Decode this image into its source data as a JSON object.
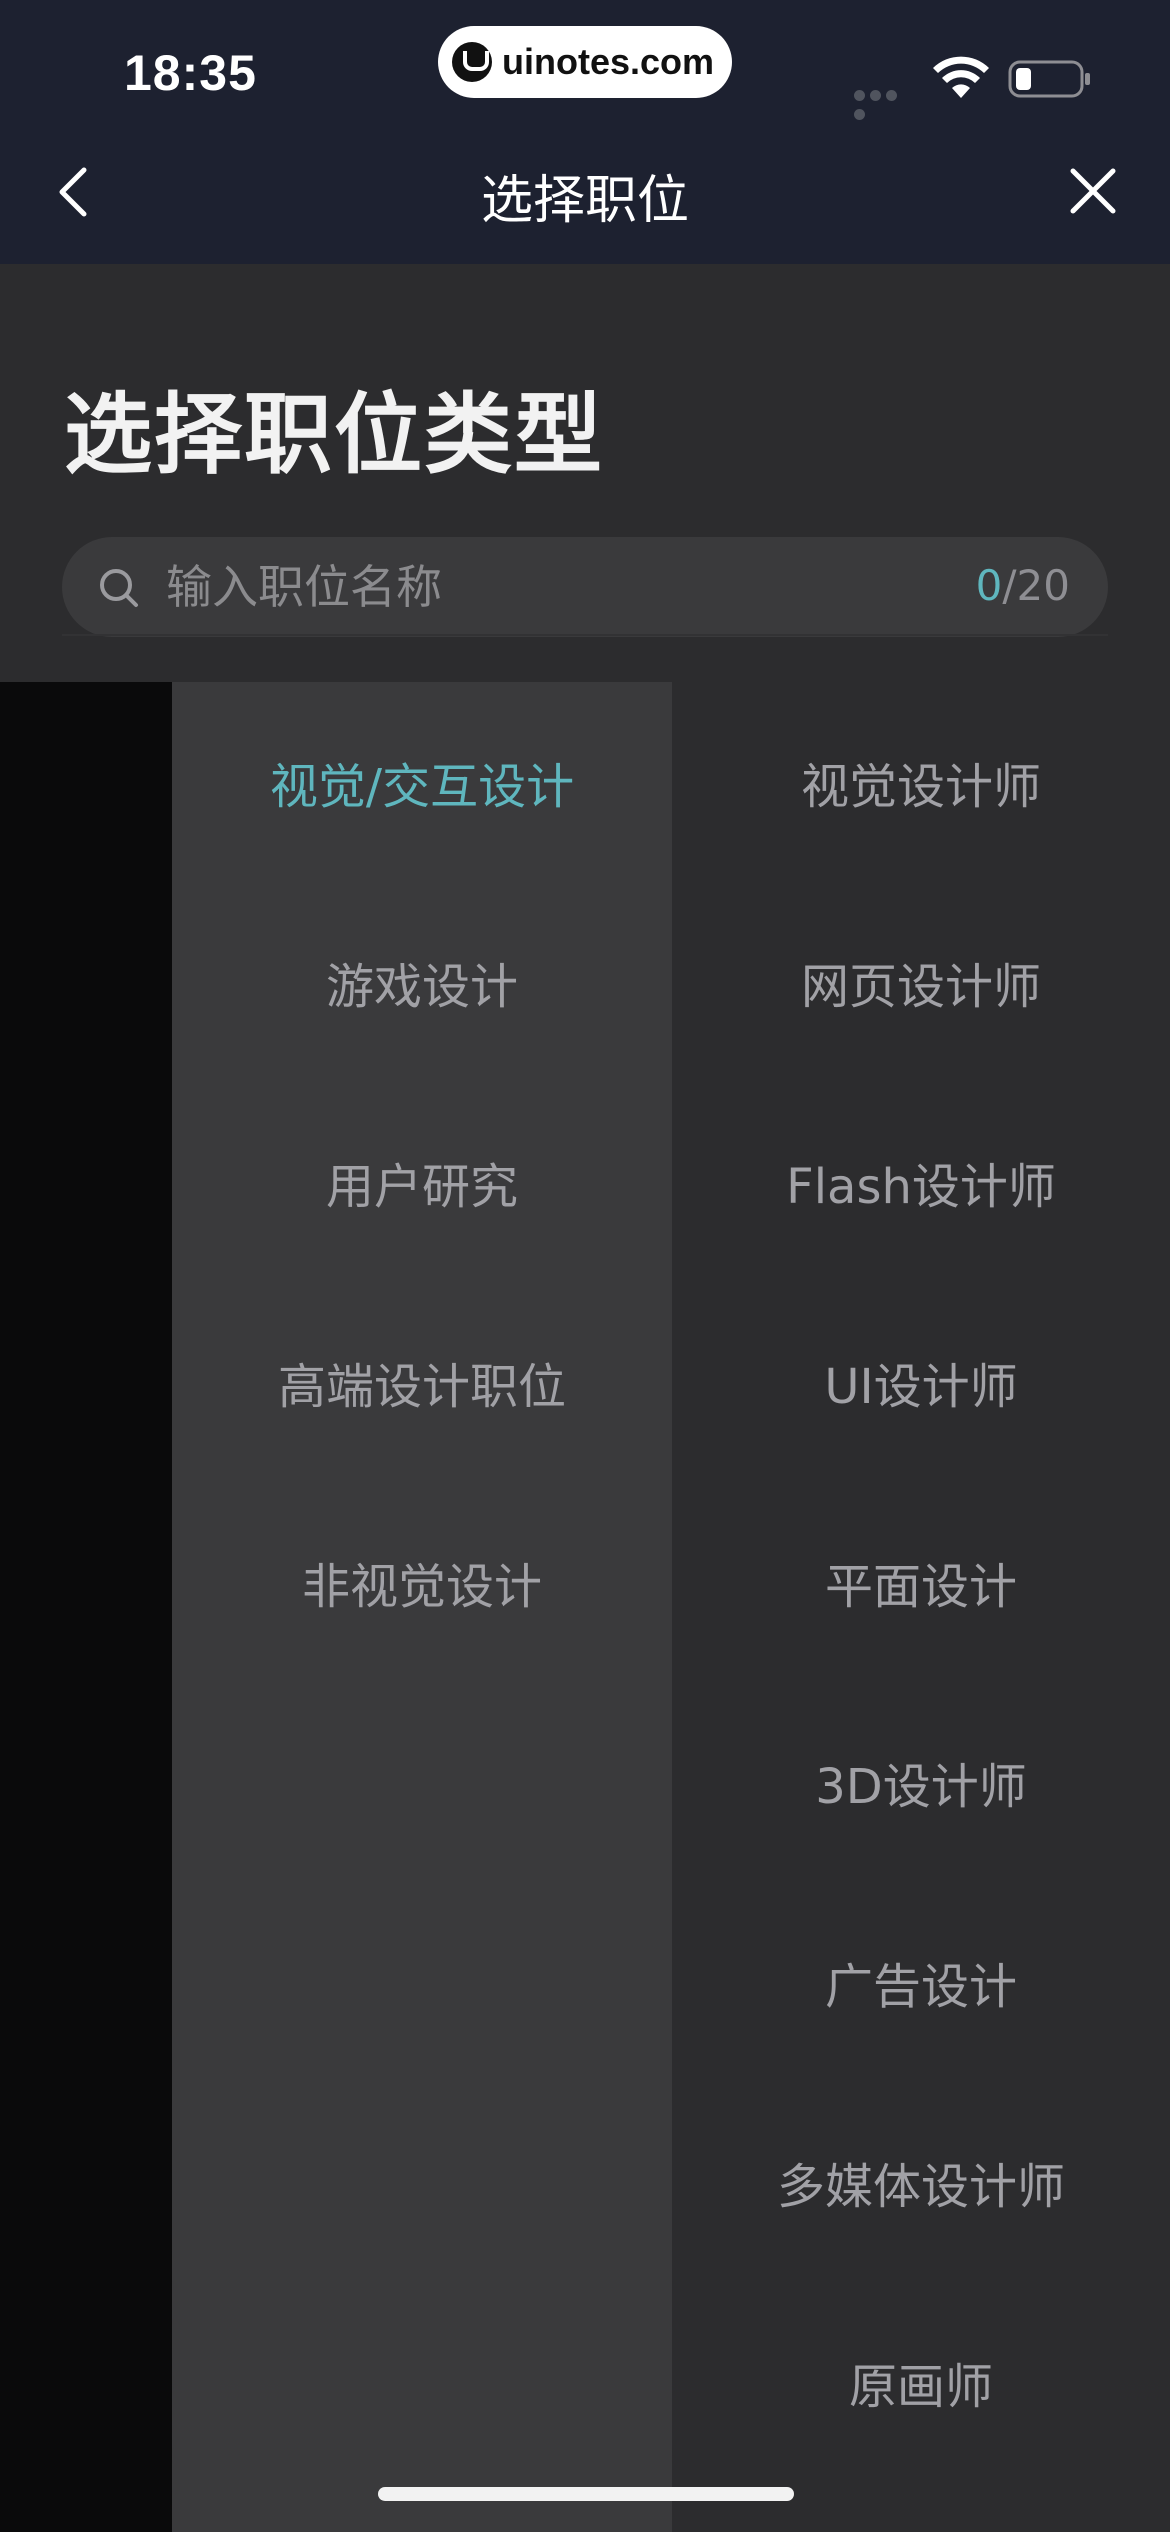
{
  "status_bar": {
    "time": "18:35",
    "watermark": "uinotes.com",
    "battery_level": 0.25
  },
  "nav": {
    "title": "选择职位",
    "back_icon": "chevron-left-icon",
    "close_icon": "close-icon"
  },
  "header": {
    "title": "选择职位类型"
  },
  "search": {
    "placeholder": "输入职位名称",
    "value": "",
    "count_current": "0",
    "count_max": "/20",
    "icon": "search-icon"
  },
  "categories": [
    {
      "label": "视觉/交互设计",
      "selected": true
    },
    {
      "label": "游戏设计",
      "selected": false
    },
    {
      "label": "用户研究",
      "selected": false
    },
    {
      "label": "高端设计职位",
      "selected": false
    },
    {
      "label": "非视觉设计",
      "selected": false
    }
  ],
  "positions": [
    {
      "label": "视觉设计师"
    },
    {
      "label": "网页设计师"
    },
    {
      "label": "Flash设计师"
    },
    {
      "label": "UI设计师"
    },
    {
      "label": "平面设计"
    },
    {
      "label": "3D设计师"
    },
    {
      "label": "广告设计"
    },
    {
      "label": "多媒体设计师"
    },
    {
      "label": "原画师"
    }
  ],
  "colors": {
    "accent": "#5fb6be",
    "nav_bg": "#1d2130",
    "text_muted": "#a1a1a6"
  }
}
